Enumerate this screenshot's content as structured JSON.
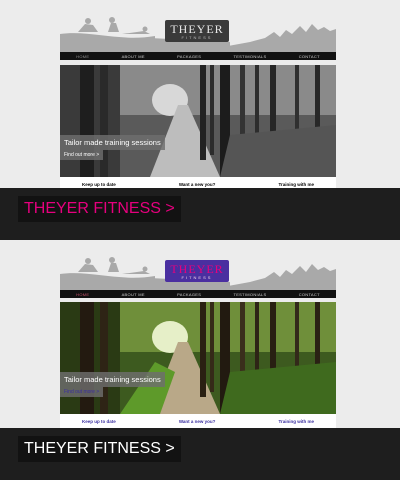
{
  "panels": [
    {
      "variant": "grayscale",
      "logo": {
        "name": "THEYER",
        "sub": "FITNESS"
      },
      "nav": [
        "HOME",
        "ABOUT ME",
        "PACKAGES",
        "TESTIMONIALS",
        "CONTACT"
      ],
      "hero": {
        "caption": "Tailor made training sessions",
        "link": "Find out more >"
      },
      "columns": [
        "Keep up to date",
        "Want a new you?",
        "Training with me"
      ],
      "banner": {
        "label": "THEYER FITNESS >",
        "color": "#e6007e"
      }
    },
    {
      "variant": "color",
      "logo": {
        "name": "THEYER",
        "sub": "FITNESS"
      },
      "nav": [
        "HOME",
        "ABOUT ME",
        "PACKAGES",
        "TESTIMONIALS",
        "CONTACT"
      ],
      "hero": {
        "caption": "Tailor made training sessions",
        "link": "Find out more >"
      },
      "columns": [
        "Keep up to date",
        "Want a new you?",
        "Training with me"
      ],
      "banner": {
        "label": "THEYER FITNESS >",
        "color": "#ffffff"
      }
    }
  ]
}
